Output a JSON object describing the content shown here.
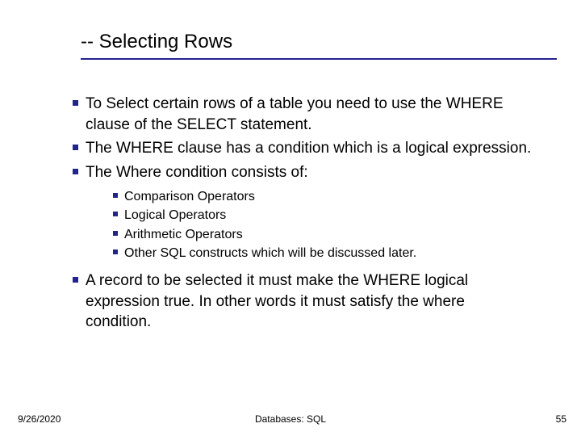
{
  "title": "-- Selecting Rows",
  "bullets": {
    "b0": "To Select certain rows of a table you need to use the WHERE clause of the SELECT statement.",
    "b1": "The WHERE clause has a condition which is a logical expression.",
    "b2": "The Where condition consists of:",
    "b3": "A record to be selected it must make the WHERE logical expression true. In other words it must satisfy the where condition."
  },
  "sub": {
    "s0": "Comparison Operators",
    "s1": "Logical Operators",
    "s2": "Arithmetic Operators",
    "s3": "Other SQL constructs which will be discussed later."
  },
  "footer": {
    "date": "9/26/2020",
    "center": "Databases: SQL",
    "page": "55"
  }
}
